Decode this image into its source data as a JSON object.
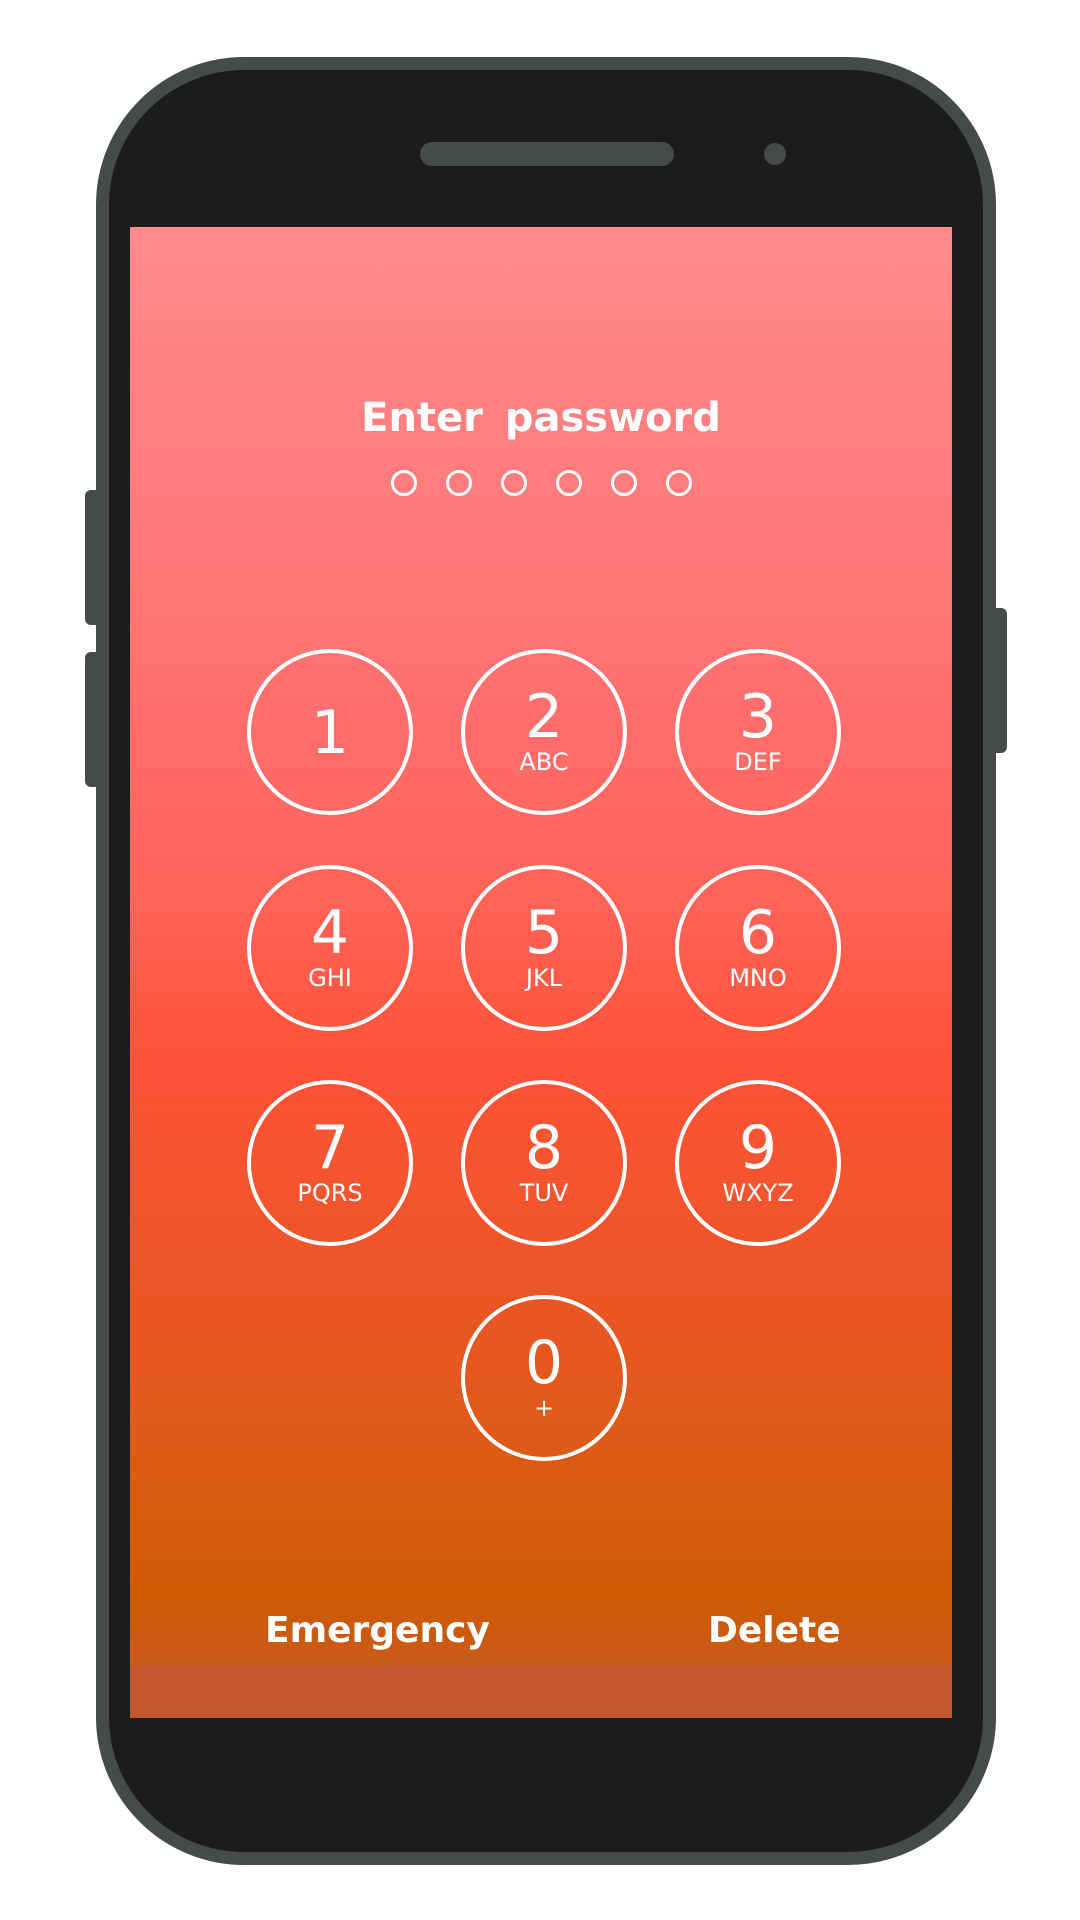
{
  "lock_screen": {
    "title": "Enter password",
    "passcode_length": 6,
    "keypad": [
      {
        "digit": "1",
        "letters": ""
      },
      {
        "digit": "2",
        "letters": "ABC"
      },
      {
        "digit": "3",
        "letters": "DEF"
      },
      {
        "digit": "4",
        "letters": "GHI"
      },
      {
        "digit": "5",
        "letters": "JKL"
      },
      {
        "digit": "6",
        "letters": "MNO"
      },
      {
        "digit": "7",
        "letters": "PQRS"
      },
      {
        "digit": "8",
        "letters": "TUV"
      },
      {
        "digit": "9",
        "letters": "WXYZ"
      },
      {
        "digit": "0",
        "letters": "+"
      }
    ],
    "emergency_label": "Emergency",
    "delete_label": "Delete"
  },
  "colors": {
    "gradient_top": "#ff8a8c",
    "gradient_middle": "#ff5237",
    "gradient_bottom": "#cd5a05",
    "phone_frame": "#474b48",
    "phone_body": "#1c1c1c"
  }
}
